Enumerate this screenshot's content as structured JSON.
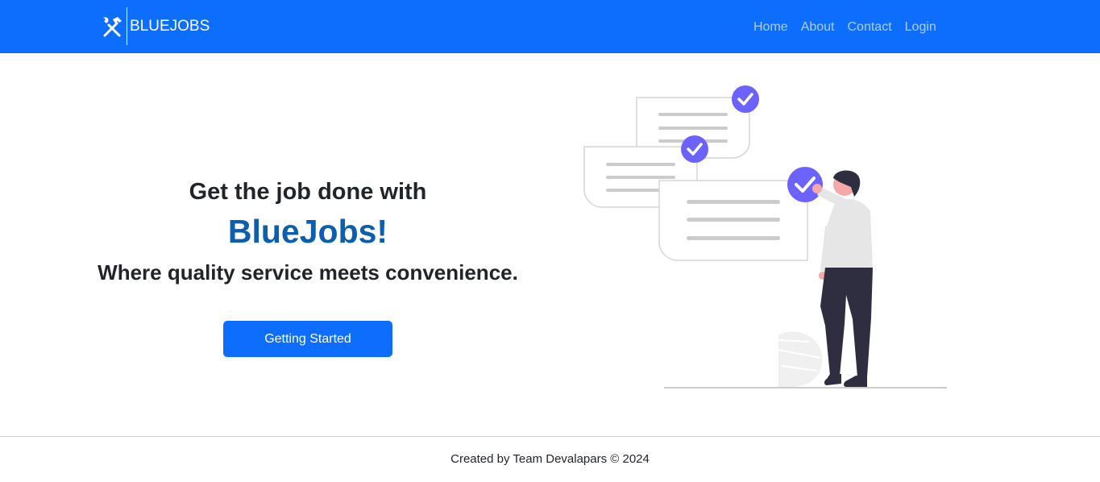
{
  "navbar": {
    "brand_text": "BLUEJOBS",
    "brand_icon": "hammer-wrench-icon",
    "links": [
      "Home",
      "About",
      "Contact",
      "Login"
    ]
  },
  "hero": {
    "line1": "Get the job done with",
    "brand": "BlueJobs!",
    "tagline": "Where quality service meets convenience.",
    "cta_label": "Getting Started"
  },
  "footer": {
    "text": "Created by Team Devalapars © 2024"
  },
  "colors": {
    "primary": "#0d6efd",
    "brand_text": "#0d5ead",
    "check_badge": "#6c63ff",
    "text_dark": "#212529"
  }
}
